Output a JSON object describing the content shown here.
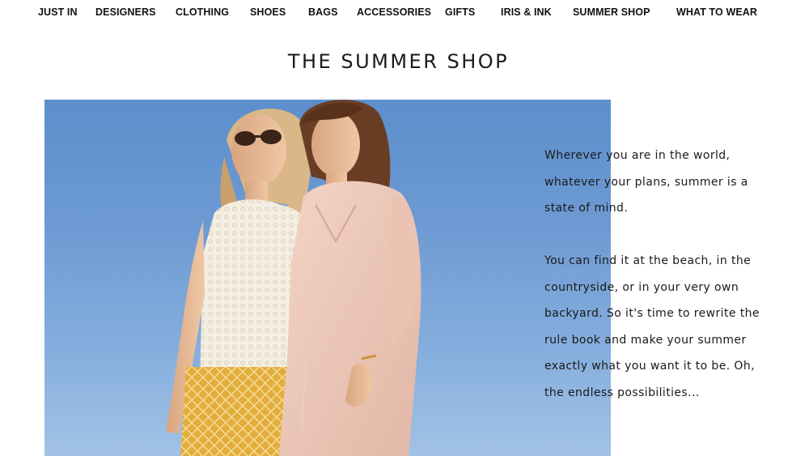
{
  "nav": {
    "items": [
      {
        "label": "JUST IN"
      },
      {
        "label": "DESIGNERS"
      },
      {
        "label": "CLOTHING"
      },
      {
        "label": "SHOES"
      },
      {
        "label": "BAGS"
      },
      {
        "label": "ACCESSORIES"
      },
      {
        "label": "GIFTS"
      },
      {
        "label": "IRIS & INK"
      },
      {
        "label": "SUMMER SHOP"
      },
      {
        "label": "WHAT TO WEAR"
      }
    ]
  },
  "page": {
    "title": "THE SUMMER SHOP"
  },
  "intro": {
    "paragraph1_lines": [
      "Wherever you are in the world,",
      "whatever your plans, summer is a",
      "state of mind."
    ],
    "paragraph2_lines": [
      "You can find it at the beach, in the",
      "countryside, or in your very own",
      "backyard. So it's time to rewrite the",
      "rule book and make your summer",
      "exactly what you want it to be. Oh,",
      "the endless possibilities..."
    ]
  },
  "colors": {
    "sky_top": "#5c8fcc",
    "sky_bottom": "#a2c2e6",
    "text": "#1a1a1a"
  }
}
